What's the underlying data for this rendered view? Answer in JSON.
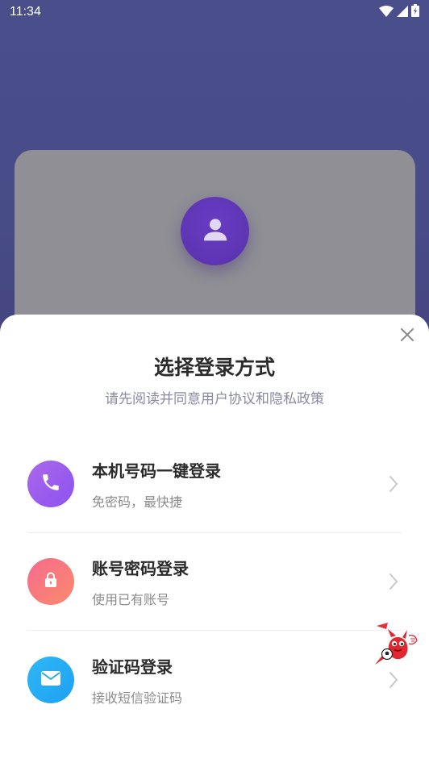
{
  "status_bar": {
    "time": "11:34",
    "icons": [
      "wifi-icon",
      "signal-icon",
      "battery-icon"
    ]
  },
  "background_card": {
    "avatar_icon": "user-icon"
  },
  "login_sheet": {
    "title": "选择登录方式",
    "subtitle": "请先阅读并同意用户协议和隐私政策",
    "close_icon": "close-icon",
    "options": [
      {
        "title": "本机号码一键登录",
        "description": "免密码，最快捷",
        "icon": "phone-icon",
        "colors": [
          "#8e52f0",
          "#a968ea"
        ]
      },
      {
        "title": "账号密码登录",
        "description": "使用已有账号",
        "icon": "lock-icon",
        "colors": [
          "#f56b8e",
          "#fb8a6c"
        ]
      },
      {
        "title": "验证码登录",
        "description": "接收短信验证码",
        "icon": "mail-icon",
        "colors": [
          "#1ea0f2",
          "#2fb8f5"
        ]
      }
    ]
  },
  "floating_widget": {
    "icon": "mascot-icon"
  }
}
